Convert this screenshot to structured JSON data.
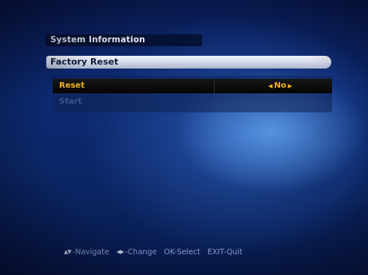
{
  "header": {
    "title": "System Information"
  },
  "menu": {
    "title": "Factory Reset"
  },
  "rows": [
    {
      "label": "Reset",
      "value": "No"
    },
    {
      "label": "Start"
    }
  ],
  "footer": {
    "navigate_label": "-Navigate",
    "change_label": "-Change",
    "select_label": "OK-Select",
    "exit_label": "EXIT-Quit"
  },
  "colors": {
    "accent": "#f0b020",
    "background": "#0d2a73",
    "title_bar": "#cfd6e6"
  },
  "icons": {
    "navigate": "up-down-arrows-icon",
    "change": "left-right-arrows-icon",
    "value_left": "arrow-left-icon",
    "value_right": "arrow-right-icon"
  }
}
